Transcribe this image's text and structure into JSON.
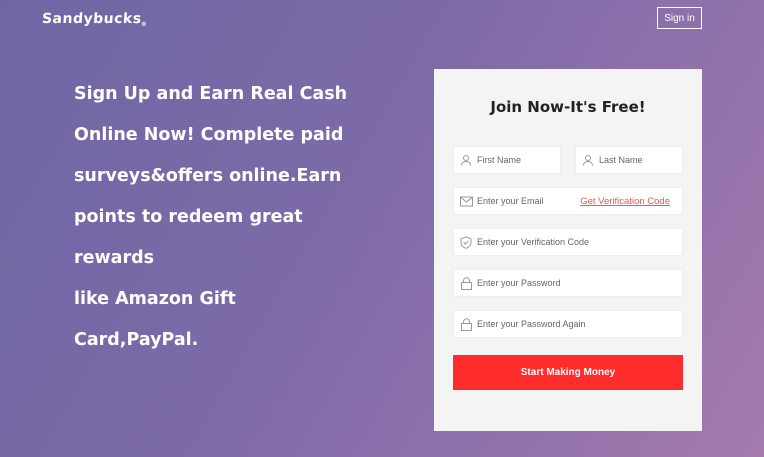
{
  "header": {
    "logo_text": "Sandybucks",
    "logo_mark": "®",
    "signin_label": "Sign in"
  },
  "hero": {
    "text": "Sign Up and Earn Real Cash\nOnline Now!  Complete paid\nsurveys&offers online.Earn\npoints to redeem great rewards\nlike Amazon Gift Card,PayPal."
  },
  "form": {
    "title": "Join Now-It's Free!",
    "first_name_placeholder": "First Name",
    "last_name_placeholder": "Last Name",
    "email_placeholder": "Enter your Email",
    "verification_link": "Get Verification Code",
    "verification_placeholder": "Enter your Verification Code",
    "password_placeholder": "Enter your Password",
    "password_again_placeholder": "Enter your Password Again",
    "submit_label": "Start Making Money",
    "icons": [
      "user-icon",
      "user-icon",
      "mail-icon",
      "shield-check-icon",
      "lock-icon",
      "lock-icon"
    ],
    "accent_color": "#ff2c2c"
  }
}
